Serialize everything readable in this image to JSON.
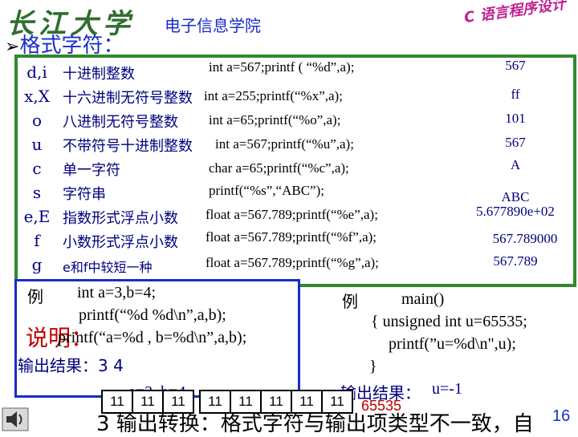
{
  "header": {
    "logo_text": "长江大学",
    "college": "电子信息学院",
    "course": "C 语言程序设计"
  },
  "section_heading": "格式字符：",
  "table": [
    {
      "fmt": "d,i",
      "desc": "十进制整数",
      "code": "int a=567;printf ( “%d”,a);",
      "result": "567"
    },
    {
      "fmt": "x,X",
      "desc": "十六进制无符号整数",
      "code": "int a=255;printf(“%x”,a);",
      "result": "ff"
    },
    {
      "fmt": "o",
      "desc": "八进制无符号整数",
      "code": "int a=65;printf(“%o”,a);",
      "result": "101"
    },
    {
      "fmt": "u",
      "desc": "不带符号十进制整数",
      "code": "int a=567;printf(“%u”,a);",
      "result": "567"
    },
    {
      "fmt": "c",
      "desc": "单一字符",
      "code": "char a=65;printf(“%c”,a);",
      "result": "A"
    },
    {
      "fmt": "s",
      "desc": "字符串",
      "code": "printf(“%s”,“ABC”);",
      "result": "ABC"
    },
    {
      "fmt": "e,E",
      "desc": "指数形式浮点小数",
      "code": "float a=567.789;printf(“%e”,a);",
      "result": "5.677890e+02"
    },
    {
      "fmt": "f",
      "desc": "小数形式浮点小数",
      "code": "float a=567.789;printf(“%f”,a);",
      "result": "567.789000"
    },
    {
      "fmt": "g",
      "desc": "e和f中较短一种",
      "code": "float a=567.789;printf(“%g”,a);",
      "result": "567.789"
    }
  ],
  "example_left": {
    "label": "例",
    "line1": "int a=3,b=4;",
    "line2": "printf(“%d %d\\n”,a,b);",
    "line3": "printf(“a=%d , b=%d\\n”,a,b);",
    "output_label": "输出结果：3  4",
    "output2": "a=3, b=4"
  },
  "note": "说明：",
  "example_right": {
    "label": "例",
    "line1": "main()",
    "line2": "{  unsigned  int  u=65535;",
    "line3": "printf(”u=%d\\n\",u);",
    "line4": "}",
    "output_label": "输出结果：",
    "output_value": "u=-1"
  },
  "bits": [
    "11",
    "11",
    "11",
    "11",
    "11",
    "11",
    "11",
    "11"
  ],
  "red_value": "65535",
  "bottom_text": "3  输出转换：格式字符与输出项类型不一致，自",
  "page_number": "16"
}
